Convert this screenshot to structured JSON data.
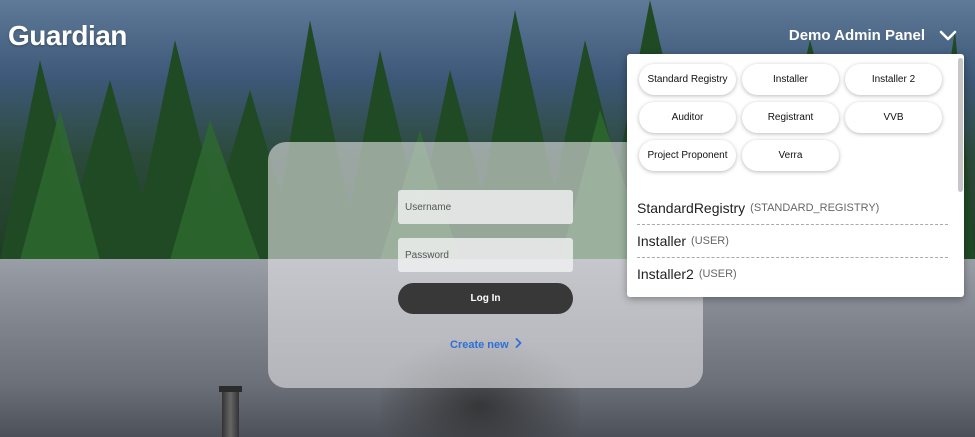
{
  "app": {
    "title": "Guardian"
  },
  "header": {
    "admin_panel_label": "Demo Admin Panel",
    "toggle_icon": "chevron-down-icon"
  },
  "login": {
    "username_placeholder": "Username",
    "password_placeholder": "Password",
    "login_label": "Log In",
    "create_label": "Create new",
    "create_icon": "chevron-right-icon",
    "link_color": "#2f6fd6"
  },
  "demo_panel": {
    "roles": [
      "Standard Registry",
      "Installer",
      "Installer 2",
      "Auditor",
      "Registrant",
      "VVB",
      "Project Proponent",
      "Verra"
    ],
    "users": [
      {
        "name": "StandardRegistry",
        "role": "(STANDARD_REGISTRY)"
      },
      {
        "name": "Installer",
        "role": "(USER)"
      },
      {
        "name": "Installer2",
        "role": "(USER)"
      }
    ]
  }
}
